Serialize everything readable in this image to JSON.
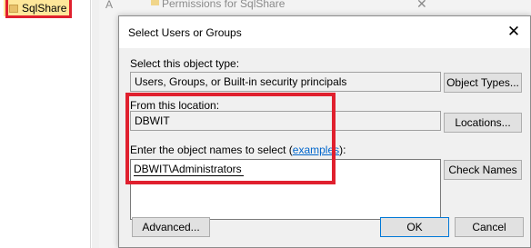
{
  "tree": {
    "item_label": "SqlShare"
  },
  "background_window": {
    "letter": "A",
    "title": "Permissions for SqlShare",
    "close": "✕"
  },
  "dialog": {
    "title": "Select Users or Groups",
    "close_glyph": "✕",
    "object_type_label": "Select this object type:",
    "object_type_value": "Users, Groups, or Built-in security principals",
    "object_types_button": "Object Types...",
    "location_label": "From this location:",
    "location_value": "DBWIT",
    "locations_button": "Locations...",
    "names_label_prefix": "Enter the object names to select (",
    "names_label_link": "examples",
    "names_label_suffix": "):",
    "names_value": "DBWIT\\Administrators",
    "check_names_button": "Check Names",
    "advanced_button": "Advanced...",
    "ok_button": "OK",
    "cancel_button": "Cancel"
  },
  "colors": {
    "annotation": "#e0202e",
    "link": "#0066cc",
    "default_button_border": "#0078d7"
  }
}
